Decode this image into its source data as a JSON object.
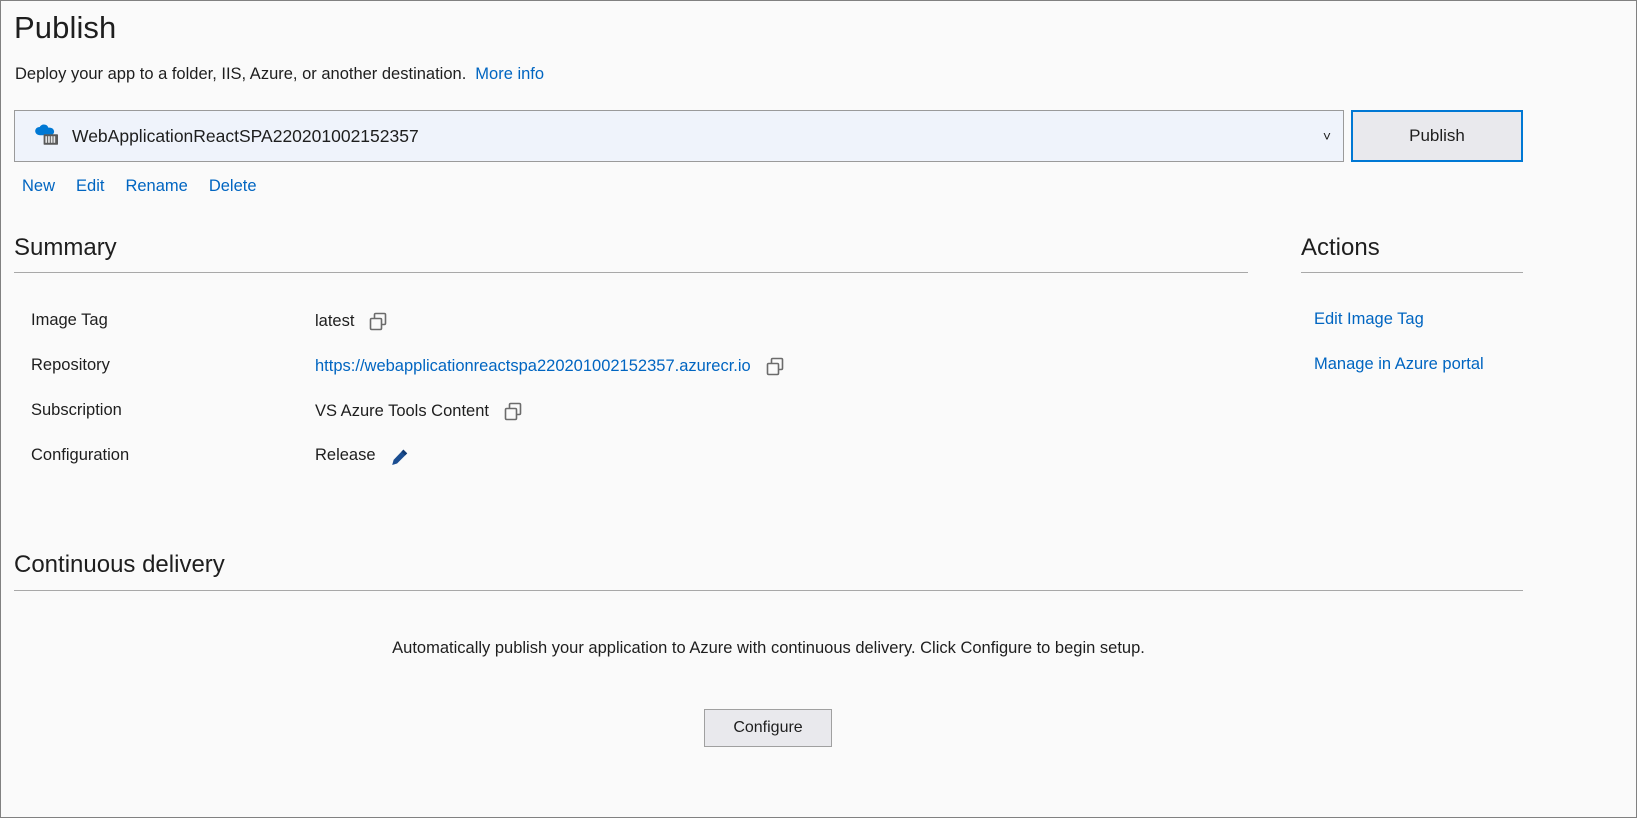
{
  "window": {
    "title": "Publish",
    "subtitle": "Deploy your app to a folder, IIS, Azure, or another destination.",
    "more_info_label": "More info"
  },
  "profile": {
    "icon": "azure-container-registry-icon",
    "selected": "WebApplicationReactSPA220201002152357",
    "chevron": "˅",
    "publish_button_label": "Publish",
    "commands": [
      {
        "label": "New"
      },
      {
        "label": "Edit"
      },
      {
        "label": "Rename"
      },
      {
        "label": "Delete"
      }
    ]
  },
  "summary": {
    "heading": "Summary",
    "rows": [
      {
        "label": "Image Tag",
        "value": "latest",
        "is_link": false,
        "trailing_icon": "copy-icon"
      },
      {
        "label": "Repository",
        "value": "https://webapplicationreactspa220201002152357.azurecr.io",
        "is_link": true,
        "trailing_icon": "copy-icon"
      },
      {
        "label": "Subscription",
        "value": "VS Azure Tools Content",
        "is_link": false,
        "trailing_icon": "copy-icon"
      },
      {
        "label": "Configuration",
        "value": "Release",
        "is_link": false,
        "trailing_icon": "pencil-icon"
      }
    ]
  },
  "actions": {
    "heading": "Actions",
    "items": [
      {
        "label": "Edit Image Tag"
      },
      {
        "label": "Manage in Azure portal"
      }
    ]
  },
  "continuous_delivery": {
    "heading": "Continuous delivery",
    "description": "Automatically publish your application to Azure with continuous delivery. Click Configure to begin setup.",
    "configure_button_label": "Configure"
  },
  "colors": {
    "link": "#0065c1",
    "accent": "#0078d4",
    "text": "#1e1e1e",
    "background": "#fafafa",
    "combo_background": "#eff3fb",
    "button_face": "#e9e9ed",
    "rule": "#a8a8a8",
    "border": "#818181"
  }
}
